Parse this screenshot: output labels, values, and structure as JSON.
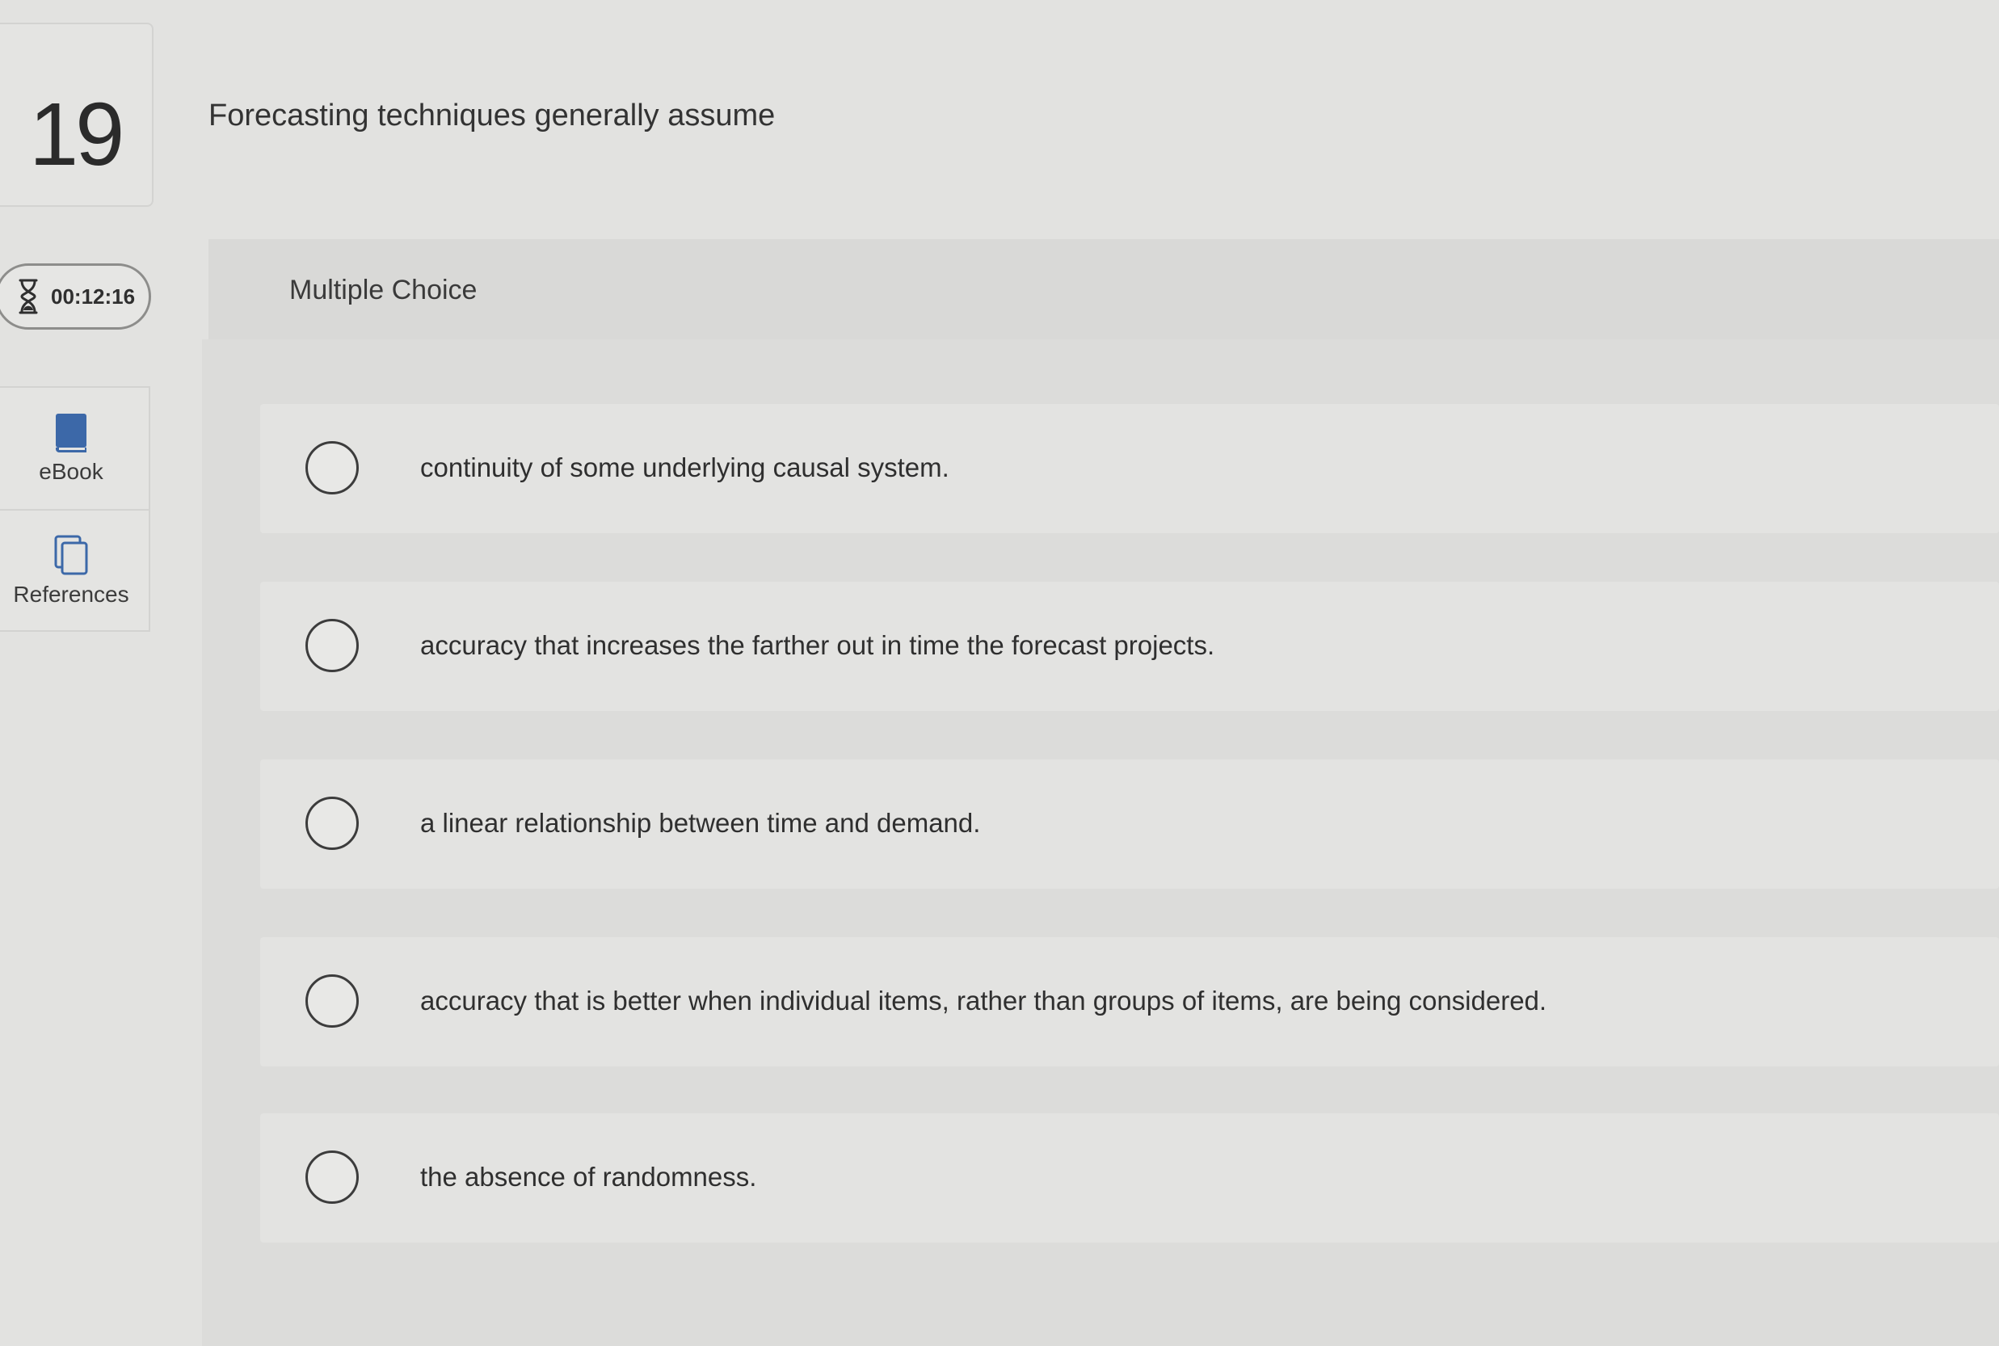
{
  "question": {
    "number": "19",
    "prompt": "Forecasting techniques generally assume"
  },
  "timer": {
    "icon": "hourglass-icon",
    "time": "00:12:16"
  },
  "tools": [
    {
      "icon": "book-icon",
      "label": "eBook"
    },
    {
      "icon": "copy-icon",
      "label": "References"
    }
  ],
  "section": {
    "type_label": "Multiple Choice"
  },
  "options": [
    {
      "text": "continuity of some underlying causal system.",
      "selected": false
    },
    {
      "text": "accuracy that increases the farther out in time the forecast projects.",
      "selected": false
    },
    {
      "text": "a linear relationship between time and demand.",
      "selected": false
    },
    {
      "text": "accuracy that is better when individual items, rather than groups of items, are being considered.",
      "selected": false
    },
    {
      "text": "the absence of randomness.",
      "selected": false
    }
  ],
  "colors": {
    "background": "#e2e2e0",
    "accent_blue": "#3c68a8",
    "text": "#2f2f2f"
  }
}
